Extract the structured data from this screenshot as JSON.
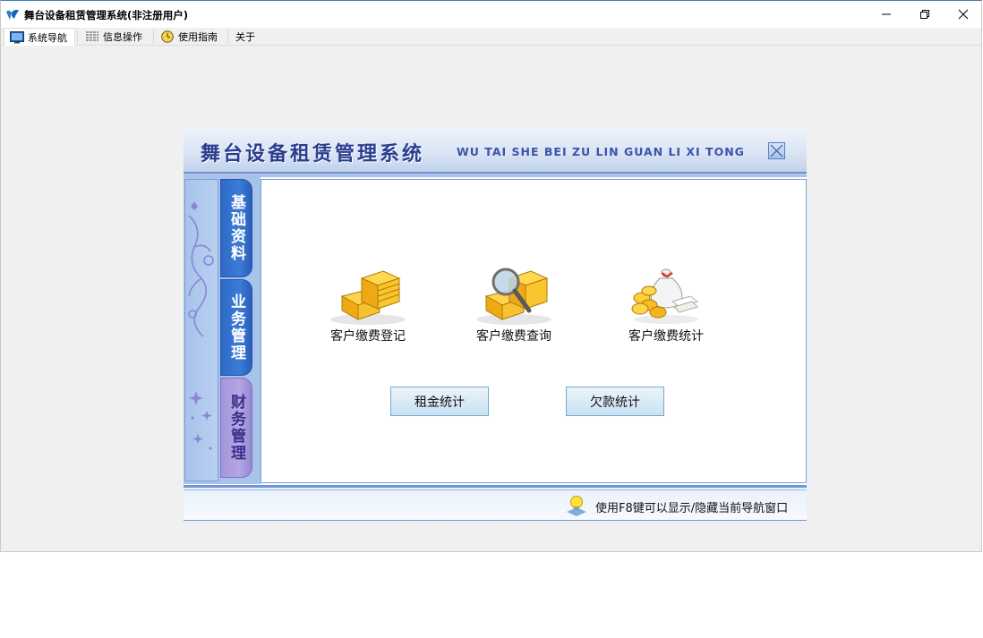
{
  "window": {
    "title": "舞台设备租赁管理系统(非注册用户)"
  },
  "menu": {
    "tabs": [
      {
        "label": "系统导航",
        "icon": "monitor-icon"
      },
      {
        "label": "信息操作",
        "icon": "grid-icon"
      },
      {
        "label": "使用指南",
        "icon": "clock-icon"
      },
      {
        "label": "关于",
        "icon": ""
      }
    ]
  },
  "panel": {
    "title": "舞台设备租赁管理系统",
    "subtitle": "WU TAI SHE BEI ZU LIN GUAN LI XI TONG",
    "side_tabs": [
      {
        "label": "基础资料"
      },
      {
        "label": "业务管理"
      },
      {
        "label": "财务管理"
      }
    ],
    "items": [
      {
        "label": "客户缴费登记",
        "icon": "coin-stack-icon"
      },
      {
        "label": "客户缴费查询",
        "icon": "coin-search-icon"
      },
      {
        "label": "客户缴费统计",
        "icon": "money-bag-icon"
      }
    ],
    "buttons": {
      "rent_stats": "租金统计",
      "arrears_stats": "欠款统计"
    },
    "footer": "使用F8键可以显示/隐藏当前导航窗口"
  },
  "colors": {
    "header_title": "#2b3d8f",
    "side_tab_blue": "#3b7bd8",
    "side_tab_purple": "#b4a7e4",
    "border_blue": "#6e96d2"
  }
}
